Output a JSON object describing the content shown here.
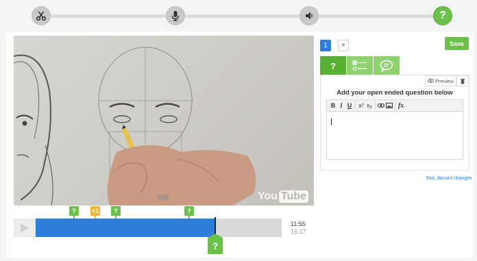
{
  "steps": [
    {
      "name": "cut",
      "icon": "scissors-icon"
    },
    {
      "name": "record",
      "icon": "microphone-icon"
    },
    {
      "name": "audio",
      "icon": "speaker-icon"
    },
    {
      "name": "questions",
      "icon": "question-icon",
      "label": "?",
      "active": true
    }
  ],
  "video": {
    "watermark_you": "You",
    "watermark_tube": "Tube"
  },
  "timeline": {
    "progress": 0.731,
    "current_time": "11:55",
    "total_time": "16:17",
    "markers": [
      {
        "label": "?",
        "color": "green",
        "position": 0.155
      },
      {
        "label": "+1",
        "color": "orange",
        "position": 0.243
      },
      {
        "label": "?",
        "color": "green",
        "position": 0.325
      },
      {
        "label": "?",
        "color": "green",
        "position": 0.625
      }
    ],
    "current_marker_label": "?"
  },
  "editor": {
    "question_number": "1",
    "add_label": "+",
    "save_label": "Save",
    "tab_open_ended_label": "?",
    "preview_label": "Preview",
    "heading": "Add your open ended question below",
    "toolbar": {
      "bold": "B",
      "italic": "I",
      "underline": "U",
      "superscript": "x²",
      "subscript": "x₂",
      "formula": "fx"
    },
    "exit_label": "Exit, discard changes"
  },
  "colors": {
    "accent_green": "#6cc04a",
    "accent_blue": "#2d7ed8",
    "marker_orange": "#f2b632"
  }
}
